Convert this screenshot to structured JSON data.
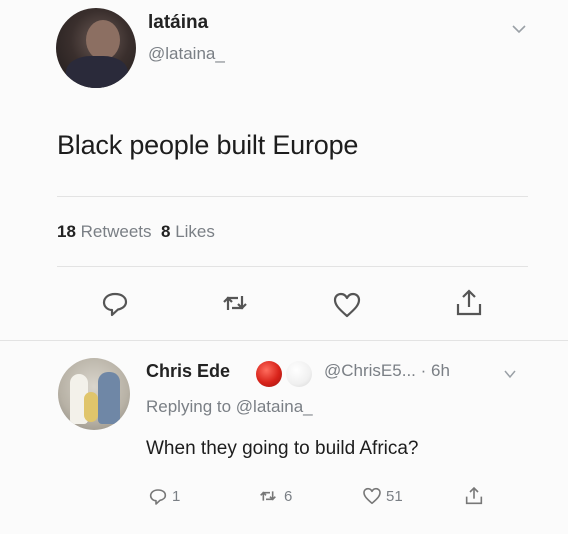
{
  "tweet": {
    "display_name": "latáina",
    "handle": "@lataina_",
    "text": "Black people built Europe",
    "retweets_count": "18",
    "retweets_label": "Retweets",
    "likes_count": "8",
    "likes_label": "Likes"
  },
  "reply": {
    "display_name": "Chris Ede",
    "handle_time": "@ChrisE5... · 6h",
    "replying_prefix": "Replying to",
    "replying_handle": "@lataina_",
    "text": "When they going to build Africa?",
    "reply_count": "1",
    "retweet_count": "6",
    "like_count": "51"
  },
  "icons": [
    "reply-icon",
    "retweet-icon",
    "like-icon",
    "share-icon",
    "chevron-down-icon"
  ],
  "colors": {
    "text": "#1d1d1d",
    "muted": "#7a7f85",
    "divider": "#e3e3e3",
    "background": "#fbfbfb"
  }
}
